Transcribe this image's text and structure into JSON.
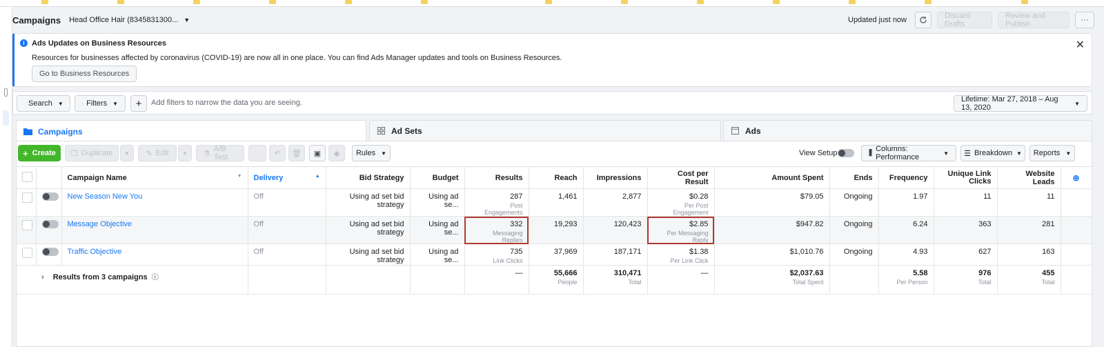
{
  "header": {
    "title": "Campaigns",
    "account": "Head Office Hair (8345831300...",
    "updated": "Updated just now",
    "discard": "Discard Drafts",
    "review": "Review and Publish",
    "more": "···"
  },
  "notice": {
    "title": "Ads Updates on Business Resources",
    "body": "Resources for businesses affected by coronavirus (COVID-19) are now all in one place. You can find Ads Manager updates and tools on Business Resources.",
    "button": "Go to Business Resources",
    "close": "✕"
  },
  "filters": {
    "search": "Search",
    "filters": "Filters",
    "add": "+",
    "hint": "Add filters to narrow the data you are seeing.",
    "date_range": "Lifetime: Mar 27, 2018 – Aug 13, 2020"
  },
  "tabs": {
    "campaigns": "Campaigns",
    "adsets": "Ad Sets",
    "ads": "Ads"
  },
  "toolbar": {
    "create": "Create",
    "duplicate": "Duplicate",
    "edit": "Edit",
    "ab_test": "A/B Test",
    "rules": "Rules",
    "view_setup": "View Setup",
    "columns": "Columns: Performance",
    "breakdown": "Breakdown",
    "reports": "Reports"
  },
  "columns": {
    "name": "Campaign Name",
    "delivery": "Delivery",
    "bid": "Bid Strategy",
    "budget": "Budget",
    "results": "Results",
    "reach": "Reach",
    "impressions": "Impressions",
    "cpr": "Cost per Result",
    "spent": "Amount Spent",
    "ends": "Ends",
    "frequency": "Frequency",
    "ulc": "Unique Link Clicks",
    "leads": "Website Leads"
  },
  "rows": [
    {
      "name": "New Season New You",
      "delivery": "Off",
      "bid": "Using ad set bid strategy",
      "budget": "Using ad se...",
      "results": "287",
      "results_sub": "Post Engagements",
      "reach": "1,461",
      "impressions": "2,877",
      "cpr": "$0.28",
      "cpr_sub": "Per Post Engagement",
      "spent": "$79.05",
      "ends": "Ongoing",
      "frequency": "1.97",
      "ulc": "11",
      "leads": "11"
    },
    {
      "name": "Message Objective",
      "delivery": "Off",
      "bid": "Using ad set bid strategy",
      "budget": "Using ad se...",
      "results": "332",
      "results_sub": "Messaging Replies",
      "reach": "19,293",
      "impressions": "120,423",
      "cpr": "$2.85",
      "cpr_sub": "Per Messaging Reply",
      "spent": "$947.82",
      "ends": "Ongoing",
      "frequency": "6.24",
      "ulc": "363",
      "leads": "281"
    },
    {
      "name": "Traffic Objective",
      "delivery": "Off",
      "bid": "Using ad set bid strategy",
      "budget": "Using ad se...",
      "results": "735",
      "results_sub": "Link Clicks",
      "reach": "37,969",
      "impressions": "187,171",
      "cpr": "$1.38",
      "cpr_sub": "Per Link Click",
      "spent": "$1,010.76",
      "ends": "Ongoing",
      "frequency": "4.93",
      "ulc": "627",
      "leads": "163"
    }
  ],
  "totals": {
    "label": "Results from 3 campaigns",
    "results": "—",
    "reach": "55,666",
    "reach_sub": "People",
    "impressions": "310,471",
    "impressions_sub": "Total",
    "cpr": "—",
    "spent": "$2,037.63",
    "spent_sub": "Total Spent",
    "frequency": "5.58",
    "frequency_sub": "Per Person",
    "ulc": "976",
    "ulc_sub": "Total",
    "leads": "455",
    "leads_sub": "Total"
  },
  "colors": {
    "accent": "#1877f2",
    "create": "#42b72a",
    "highlight": "#b03a2e"
  }
}
